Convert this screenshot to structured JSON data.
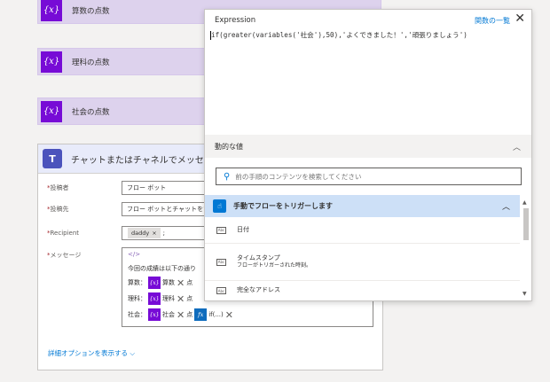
{
  "variables": [
    {
      "icon": "{x}",
      "label": "算数の点数"
    },
    {
      "icon": "{x}",
      "label": "理科の点数"
    },
    {
      "icon": "{x}",
      "label": "社会の点数"
    }
  ],
  "teams_card": {
    "title": "チャットまたはチャネルでメッセージ",
    "fields": {
      "poster": {
        "label": "投稿者",
        "value": "フロー ボット"
      },
      "post_in": {
        "label": "投稿先",
        "value": "フロー ボットとチャットをす"
      },
      "recipient": {
        "label": "Recipient",
        "chip": "daddy",
        "suffix": ";"
      },
      "message": {
        "label": "メッセージ"
      }
    },
    "message": {
      "code_icon": "</>",
      "line1": "今回の成績は以下の通り",
      "line2_prefix": "算数：",
      "line2_token": "算数",
      "line2_suffix": "点",
      "line3_prefix": "理科：",
      "line3_token": "理科",
      "line3_suffix": "点",
      "line4_prefix": "社会：",
      "line4_token": "社会",
      "line4_suffix": "点",
      "fx_token": "if(...)"
    },
    "advanced_link": "詳細オプションを表示する"
  },
  "expression_panel": {
    "title": "Expression",
    "function_list_link": "関数の一覧",
    "expression": "if(greater(variables('社会'),50),'よくできました！','頑張りましょう')",
    "dynamic_header": "動的な値",
    "search_placeholder": "前の手順のコンテンツを検索してください",
    "trigger_title": "手動でフローをトリガーします",
    "items": [
      {
        "title": "日付",
        "desc": ""
      },
      {
        "title": "タイムスタンプ",
        "desc": "フローがトリガーされた時刻。"
      },
      {
        "title": "完全なアドレス",
        "desc": ""
      }
    ]
  }
}
